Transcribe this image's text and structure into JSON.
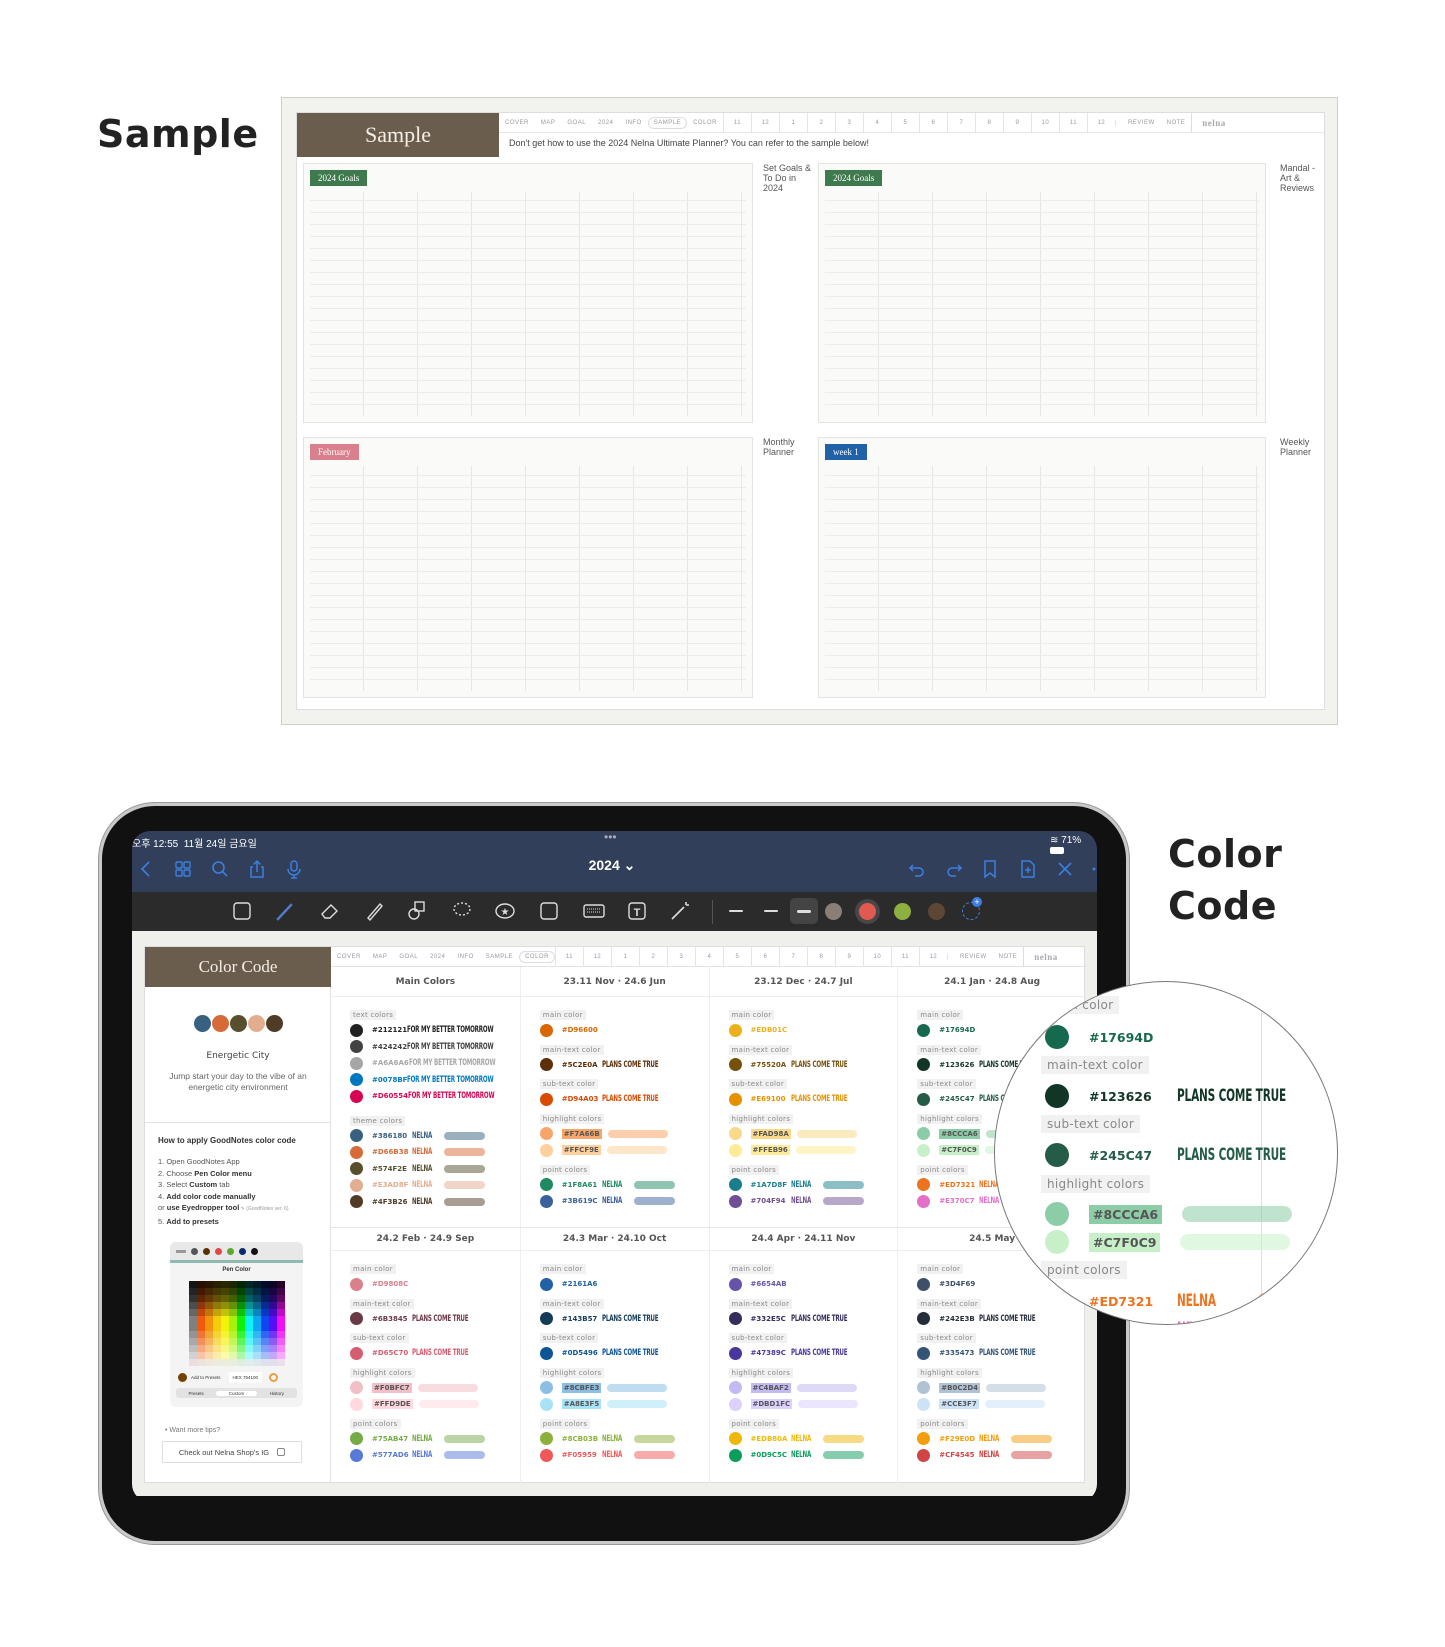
{
  "sample_section": {
    "heading": "Sample",
    "page_title": "Sample",
    "notice": "Don't get how to use the 2024 Nelna Ultimate Planner? You can refer to the sample below!",
    "thumbnails": [
      {
        "tag": "2024 Goals",
        "label": "Set Goals & To Do in 2024",
        "color": "#3f7a4f"
      },
      {
        "tag": "2024 Goals",
        "label": "Mandal -Art & Reviews",
        "color": "#3f7a4f"
      },
      {
        "tag": "February",
        "label": "Monthly Planner",
        "color": "#d9808c"
      },
      {
        "tag": "week 1",
        "label": "Weekly Planner",
        "color": "#2161a6"
      }
    ]
  },
  "color_code_heading": [
    "Color",
    "Code"
  ],
  "nav_tabs": {
    "sections": [
      "COVER",
      "MAP",
      "GOAL",
      "2024",
      "INFO",
      "SAMPLE",
      "COLOR"
    ],
    "months": [
      "11",
      "12",
      "1",
      "2",
      "3",
      "4",
      "5",
      "6",
      "7",
      "8",
      "9",
      "10",
      "11",
      "12"
    ],
    "extras": [
      "REVIEW",
      "NOTE"
    ],
    "brand": "nelna"
  },
  "ipad": {
    "status_time": "오후 12:55",
    "status_date": "11월 24일 금요일",
    "battery": "71%",
    "doc_title": "2024 ⌄",
    "nav_icons": [
      "back-icon",
      "grid-icon",
      "search-icon",
      "share-icon",
      "microphone-icon"
    ],
    "nav_right_icons": [
      "undo-icon",
      "redo-icon",
      "bookmark-icon",
      "add-page-icon",
      "close-icon",
      "more-icon"
    ],
    "tool_icons": [
      "zoom-window-icon",
      "pen-icon",
      "eraser-icon",
      "highlighter-icon",
      "shapes-icon",
      "lasso-icon",
      "sticker-icon",
      "image-icon",
      "keyboard-icon",
      "text-icon",
      "laser-pointer-icon"
    ],
    "pen_colors": [
      "#8a7f76",
      "#e05a52",
      "#8db040",
      "#5e4634"
    ],
    "selected_pen_color": "#e05a52"
  },
  "planner": {
    "title": "Color Code",
    "palette": [
      "#386180",
      "#D66B38",
      "#574F2E",
      "#E3AD8F",
      "#4F3B26"
    ],
    "theme_name": "Energetic City",
    "theme_desc": "Jump start your day to the vibe of an energetic city environment",
    "howto_title": "How to apply GoodNotes color code",
    "steps": [
      {
        "pre": "1. Open GoodNotes App",
        "bold": "",
        "post": ""
      },
      {
        "pre": "2. Choose ",
        "bold": "Pen Color menu",
        "post": ""
      },
      {
        "pre": "3. Select ",
        "bold": "Custom",
        "post": " tab"
      },
      {
        "pre": "4. ",
        "bold": "Add color code manually",
        "post": ""
      },
      {
        "pre": "    or ",
        "bold": "use Eyedropper tool",
        "post": " ✎ (GoodNotes ver. 6)"
      },
      {
        "pre": "5. ",
        "bold": "Add to presets",
        "post": ""
      }
    ],
    "picker": {
      "title": "Pen Color",
      "presets_swatches": [
        "#555555",
        "#5a3000",
        "#e04848",
        "#5aa830",
        "#0a2a70",
        "#111111"
      ],
      "add_to_presets": "Add to Presets",
      "hex_value": "HEX 754100",
      "tabs": [
        "Presets",
        "Custom",
        "History"
      ]
    },
    "tips_label": "• Want more tips?",
    "ig_button": "Check out Nelna Shop's IG",
    "samples": {
      "tomorrow": "FOR MY BETTER TOMORROW",
      "plans": "PLANS COME TRUE",
      "nelna": "NELNA"
    },
    "labels": {
      "main": "main color",
      "main_text": "main-text color",
      "sub_text": "sub-text color",
      "highlight": "highlight colors",
      "point": "point colors",
      "text_colors": "text colors",
      "theme_colors": "theme colors"
    },
    "main_colors": {
      "title": "Main Colors",
      "text_colors": [
        "#212121",
        "#424242",
        "#A6A6A6",
        "#0078BF",
        "#D60554"
      ],
      "theme_colors": [
        "#386180",
        "#D66B38",
        "#574F2E",
        "#E3AD8F",
        "#4F3B26"
      ]
    },
    "periods": [
      {
        "title": "23.11 Nov · 24.6 Jun",
        "main": "#D96600",
        "main_text": "#5C2E0A",
        "sub_text": "#D94A03",
        "highlight": [
          "#F7A66B",
          "#FFCF9E"
        ],
        "point": [
          "#1F8A61",
          "#3B619C"
        ]
      },
      {
        "title": "23.12 Dec · 24.7 Jul",
        "main": "#EDB01C",
        "main_text": "#75520A",
        "sub_text": "#E69100",
        "highlight": [
          "#FAD98A",
          "#FFEB96"
        ],
        "point": [
          "#1A7D8F",
          "#704F94"
        ]
      },
      {
        "title": "24.1 Jan · 24.8 Aug",
        "main": "#17694D",
        "main_text": "#123626",
        "sub_text": "#245C47",
        "highlight": [
          "#8CCCA6",
          "#C7F0C9"
        ],
        "point": [
          "#ED7321",
          "#E370C7"
        ]
      },
      {
        "title": "24.2 Feb · 24.9 Sep",
        "main": "#D9808C",
        "main_text": "#6B3845",
        "sub_text": "#D65C70",
        "highlight": [
          "#F0BFC7",
          "#FFD9DE"
        ],
        "point": [
          "#75AB47",
          "#577AD6"
        ]
      },
      {
        "title": "24.3 Mar · 24.10 Oct",
        "main": "#2161A6",
        "main_text": "#143B57",
        "sub_text": "#0D5496",
        "highlight": [
          "#8CBFE3",
          "#A8E3F5"
        ],
        "point": [
          "#8CB03B",
          "#F05959"
        ]
      },
      {
        "title": "24.4 Apr · 24.11 Nov",
        "main": "#6654AB",
        "main_text": "#332E5C",
        "sub_text": "#47389C",
        "highlight": [
          "#C4BAF2",
          "#DBD1FC"
        ],
        "point": [
          "#EDB80A",
          "#0D9C5C"
        ]
      },
      {
        "title": "24.5 May",
        "main": "#3D4F69",
        "main_text": "#242E3B",
        "sub_text": "#335473",
        "highlight": [
          "#B0C2D4",
          "#CCE3F7"
        ],
        "point": [
          "#F29E0D",
          "#CF4545"
        ]
      }
    ],
    "magnified_period": 2
  }
}
